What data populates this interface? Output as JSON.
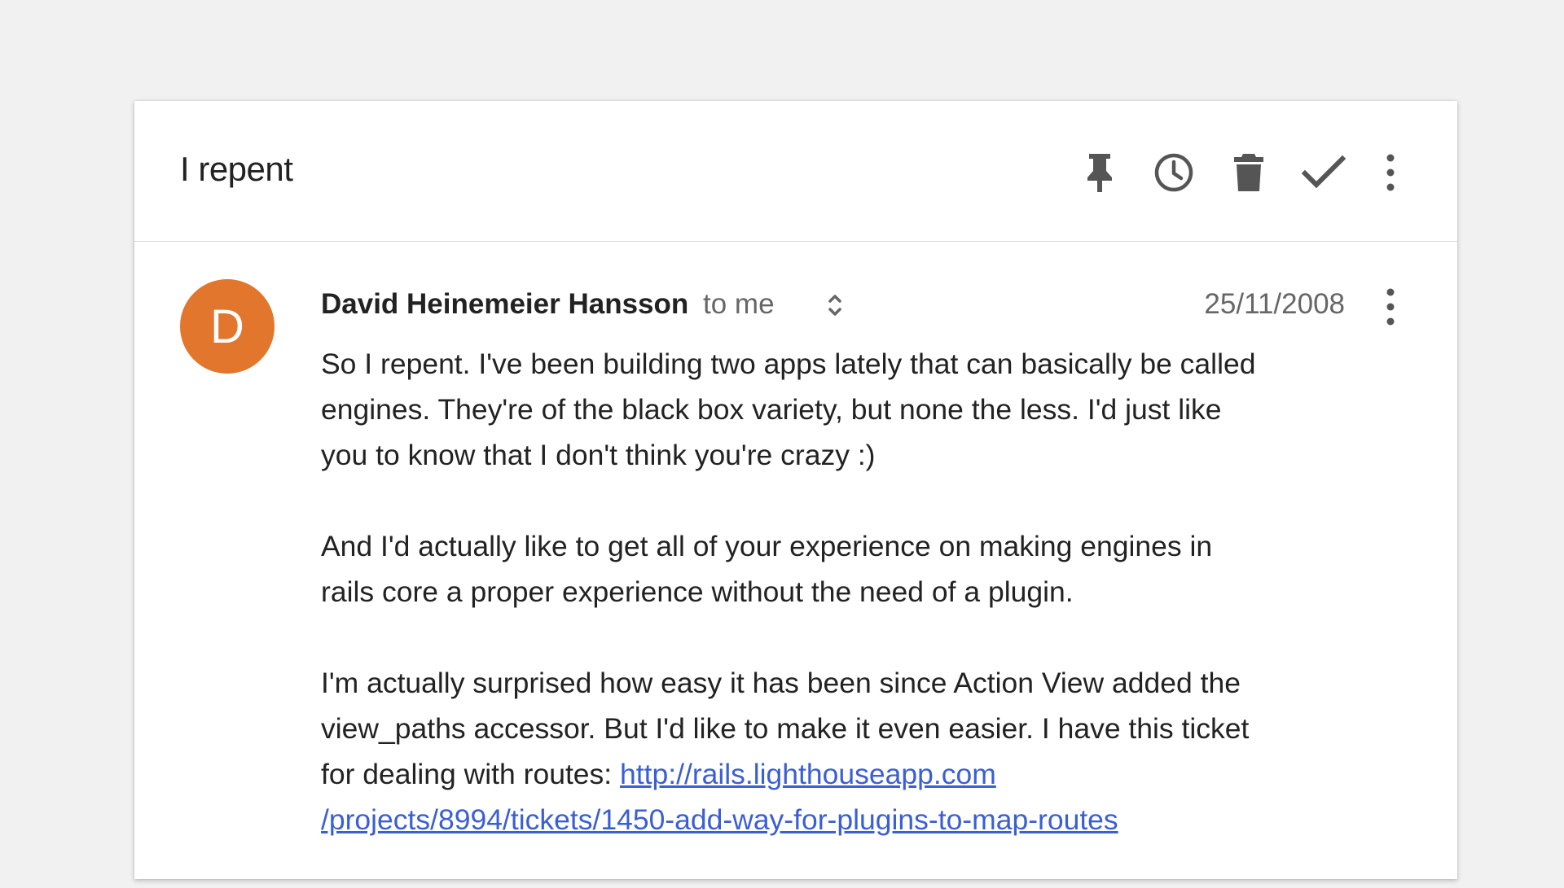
{
  "email": {
    "subject": "I repent",
    "toolbar": {
      "pin_icon": "pin-icon",
      "snooze_icon": "clock-icon",
      "delete_icon": "trash-icon",
      "done_icon": "checkmark-icon",
      "more_icon": "more-vert-icon"
    },
    "message": {
      "avatar_letter": "D",
      "avatar_color": "#e2762c",
      "sender": "David Heinemeier Hansson",
      "recipient": "to me",
      "date": "25/11/2008",
      "paragraphs": [
        "So I repent. I've been building two apps lately that can basically be called engines. They're of the black box variety, but none the less. I'd just like you to know that I don't think you're crazy :)",
        "And I'd actually like to get all of your experience on making engines in rails core a proper experience without the need of a plugin."
      ],
      "paragraph3_text": "I'm actually surprised how easy it has been since Action View added the view_paths accessor. But I'd like to make it even easier. I have this ticket for dealing with routes: ",
      "link_line1": "http://rails.lighthouseapp.com",
      "link_line2": "/projects/8994/tickets/1450-add-way-for-plugins-to-map-routes",
      "link_color": "#3a5fd4"
    }
  }
}
